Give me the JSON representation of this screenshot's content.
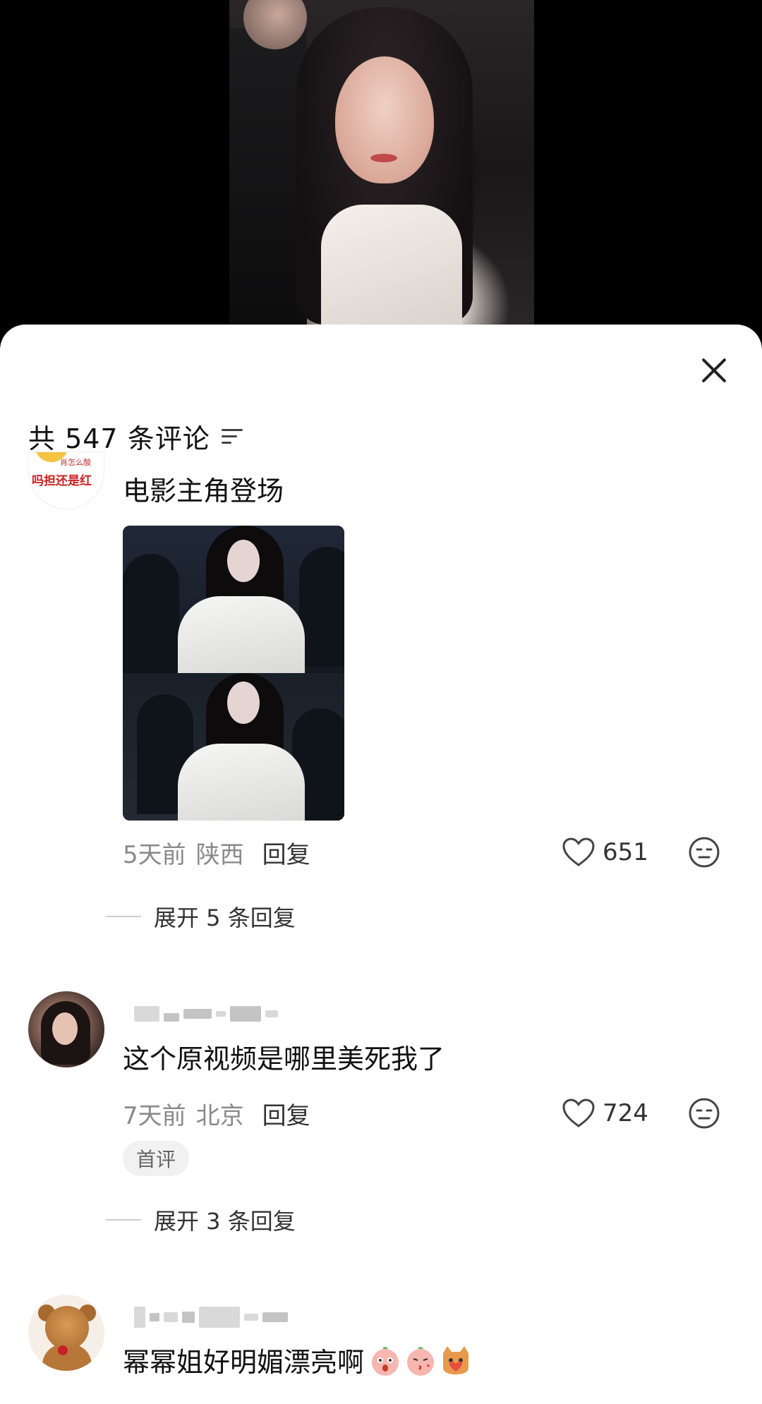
{
  "sheet": {
    "comment_count": "共 547 条评论"
  },
  "comments": [
    {
      "text": "电影主角登场",
      "time": "5天前",
      "location": "陕西",
      "reply_label": "回复",
      "likes": "651",
      "expand_label": "展开 5 条回复",
      "avatar_text_1": "肖怎么酸",
      "avatar_text_2": "吗担还是红"
    },
    {
      "text": "这个原视频是哪里美死我了",
      "time": "7天前",
      "location": "北京",
      "reply_label": "回复",
      "likes": "724",
      "badge": "首评",
      "expand_label": "展开 3 条回复"
    },
    {
      "text": "幂幂姐好明媚漂亮啊"
    }
  ],
  "colors": {
    "sheet_bg": "#ffffff",
    "text_primary": "#111111",
    "text_secondary": "#8a8a8a"
  }
}
